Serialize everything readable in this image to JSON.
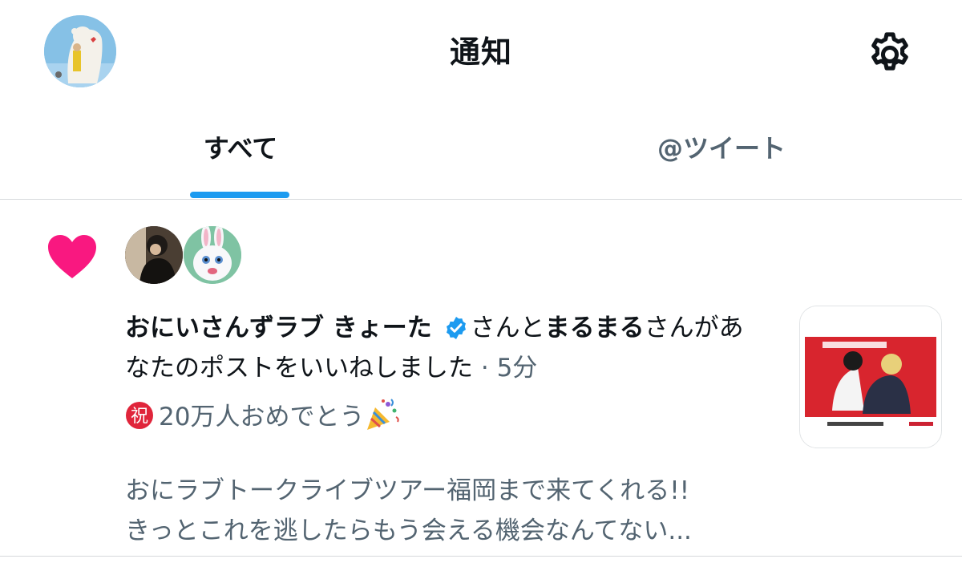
{
  "header": {
    "title": "通知",
    "avatar_icon": "user-avatar-bear-illustration",
    "settings_icon": "gear-icon"
  },
  "tabs": [
    {
      "label": "すべて",
      "active": true
    },
    {
      "label": "@ツイート",
      "active": false
    }
  ],
  "colors": {
    "accent": "#1d9bf0",
    "like": "#f91880",
    "text_primary": "#0f1419",
    "text_secondary": "#536471"
  },
  "notification": {
    "type_icon": "heart-icon",
    "user1": "おにいさんずラブ きょーた",
    "user1_verified": true,
    "connector": "さんと",
    "user2": "まるまる",
    "suffix": "さんがあなたのポストをいいねしました",
    "time_sep": " · ",
    "time": "5分",
    "post_line1": "20万人おめでとう",
    "post_line3": "おにラブトークライブツアー福岡まで来てくれる!!",
    "post_line4": "きっとこれを逃したらもう会える機会なんてない..."
  }
}
